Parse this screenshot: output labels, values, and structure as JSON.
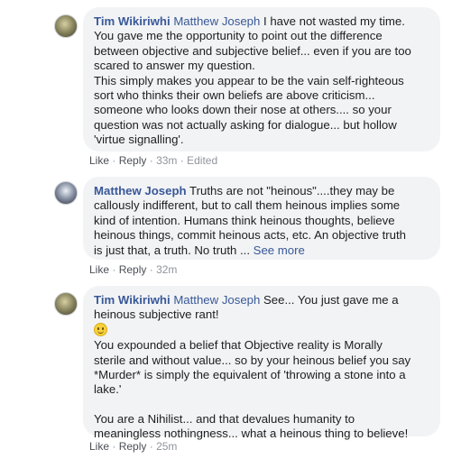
{
  "comments": [
    {
      "author": "Tim Wikiriwhi",
      "mention": "Matthew Joseph",
      "first_line_text": "I have not wasted my time.",
      "lines": [
        "You gave me the opportunity to point out the difference",
        "between objective and subjective belief... even if you are too",
        "scared to answer my question.",
        "This simply makes you appear to be the vain self-righteous",
        "sort who thinks their own beliefs are above criticism...",
        "someone who looks down their nose at others.... so your",
        "question was not actually asking for dialogue... but hollow",
        "'virtue signalling'."
      ],
      "actions": {
        "like": "Like",
        "reply": "Reply",
        "time": "33m",
        "edited": "Edited",
        "sep": "·"
      }
    },
    {
      "author": "Matthew Joseph",
      "first_line_text": "Truths are not \"heinous\"....they may be",
      "lines": [
        "callously indifferent, but to call them heinous implies some",
        "kind of intention. Humans think heinous thoughts, believe",
        "heinous things, commit heinous acts, etc. An objective truth"
      ],
      "last_line_text": "is just that, a truth. No truth ...",
      "see_more": "See more",
      "actions": {
        "like": "Like",
        "reply": "Reply",
        "time": "32m",
        "sep": "·"
      }
    },
    {
      "author": "Tim Wikiriwhi",
      "mention": "Matthew Joseph",
      "first_line_text": "See... You just gave me a",
      "line2": "heinous subjective rant!",
      "emoji": "slightly-smiling-face-icon",
      "lines": [
        "You expounded a belief that Objective reality is Morally",
        "sterile and without value... so by your heinous belief you say",
        "*Murder* is simply the equivalent of 'throwing a stone into a",
        "lake.'"
      ],
      "lines_b": [
        "You are a Nihilist... and that devalues humanity to",
        "meaningless nothingness... what a heinous thing to believe!"
      ],
      "actions": {
        "like": "Like",
        "reply": "Reply",
        "time": "25m",
        "sep": "·"
      }
    }
  ]
}
